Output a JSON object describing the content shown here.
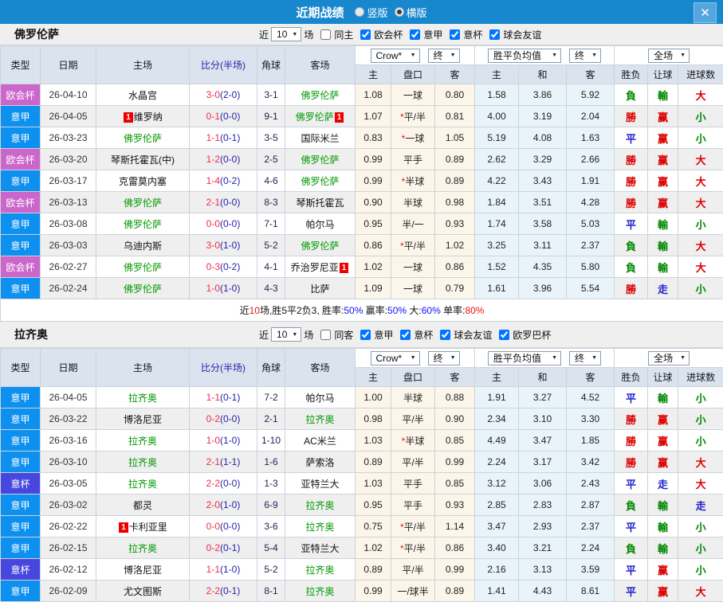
{
  "colors": {
    "titlebar": "#1787CE",
    "close-btn": "#53A7DE",
    "header-bg": "#DBE3EE",
    "euro-badge": "#CB66CB",
    "seriea-badge": "#0D90F0",
    "coppa-badge": "#4747DE",
    "self-team-green": "#009900",
    "score-red": "#F32A52",
    "score-half-navy": "#241FA8",
    "win-red": "#DD0000",
    "loss-green": "#008800",
    "draw-blue": "#2222CC",
    "odds-bg-cream": "#FCF5EA",
    "avg-bg-blue": "#E9F4FA",
    "redcard": "#EE0000"
  },
  "titlebar": {
    "title": "近期战绩",
    "close_glyph": "✕",
    "radios": [
      {
        "label": "竖版",
        "selected": false
      },
      {
        "label": "横版",
        "selected": true
      }
    ]
  },
  "table": {
    "left_headers": [
      "类型",
      "日期",
      "主场",
      "比分(半场)",
      "角球",
      "客场"
    ],
    "sub_headers": [
      "主",
      "盘口",
      "客",
      "主",
      "和",
      "客",
      "胜负",
      "让球",
      "进球数"
    ],
    "odds_dd": "Crow*",
    "odds_final_dd": "终",
    "avg_dd": "胜平负均值",
    "avg_final_dd": "终",
    "scope_dd": "全场"
  },
  "sections": [
    {
      "team": "佛罗伦萨",
      "near_label": "近",
      "count": "10",
      "games_label": "场",
      "same_label": "同主",
      "same_checked": false,
      "leagues": [
        {
          "label": "欧会杯",
          "checked": true
        },
        {
          "label": "意甲",
          "checked": true
        },
        {
          "label": "意杯",
          "checked": true
        },
        {
          "label": "球会友谊",
          "checked": true
        }
      ],
      "rows": [
        {
          "type": "欧会杯",
          "date": "26-04-10",
          "home": "水晶宫",
          "home_self": false,
          "score": "3-0",
          "half": "2-0",
          "corner": "3-1",
          "away": "佛罗伦萨",
          "away_self": true,
          "odds_home": "1.08",
          "handicap": "一球",
          "handicap_star": false,
          "odds_away": "0.80",
          "avg": [
            "1.58",
            "3.86",
            "5.92"
          ],
          "res": [
            [
              "負",
              "g"
            ],
            [
              "輸",
              "g"
            ],
            [
              "大",
              "r"
            ]
          ]
        },
        {
          "type": "意甲",
          "date": "26-04-05",
          "home": "维罗纳",
          "home_self": false,
          "home_badge": "1",
          "score": "0-1",
          "half": "0-0",
          "corner": "9-1",
          "away": "佛罗伦萨",
          "away_self": true,
          "away_badge": "1",
          "odds_home": "1.07",
          "handicap": "平/半",
          "handicap_star": true,
          "odds_away": "0.81",
          "avg": [
            "4.00",
            "3.19",
            "2.04"
          ],
          "res": [
            [
              "勝",
              "r"
            ],
            [
              "赢",
              "r"
            ],
            [
              "小",
              "g"
            ]
          ]
        },
        {
          "type": "意甲",
          "date": "26-03-23",
          "home": "佛罗伦萨",
          "home_self": true,
          "score": "1-1",
          "half": "0-1",
          "corner": "3-5",
          "away": "国际米兰",
          "away_self": false,
          "odds_home": "0.83",
          "handicap": "一球",
          "handicap_star": true,
          "odds_away": "1.05",
          "avg": [
            "5.19",
            "4.08",
            "1.63"
          ],
          "res": [
            [
              "平",
              "b"
            ],
            [
              "赢",
              "r"
            ],
            [
              "小",
              "g"
            ]
          ]
        },
        {
          "type": "欧会杯",
          "date": "26-03-20",
          "home": "琴斯托霍瓦(中)",
          "home_self": false,
          "score": "1-2",
          "half": "0-0",
          "corner": "2-5",
          "away": "佛罗伦萨",
          "away_self": true,
          "odds_home": "0.99",
          "handicap": "平手",
          "handicap_star": false,
          "odds_away": "0.89",
          "avg": [
            "2.62",
            "3.29",
            "2.66"
          ],
          "res": [
            [
              "勝",
              "r"
            ],
            [
              "赢",
              "r"
            ],
            [
              "大",
              "r"
            ]
          ]
        },
        {
          "type": "意甲",
          "date": "26-03-17",
          "home": "克雷莫内塞",
          "home_self": false,
          "score": "1-4",
          "half": "0-2",
          "corner": "4-6",
          "away": "佛罗伦萨",
          "away_self": true,
          "odds_home": "0.99",
          "handicap": "半球",
          "handicap_star": true,
          "odds_away": "0.89",
          "avg": [
            "4.22",
            "3.43",
            "1.91"
          ],
          "res": [
            [
              "勝",
              "r"
            ],
            [
              "赢",
              "r"
            ],
            [
              "大",
              "r"
            ]
          ]
        },
        {
          "type": "欧会杯",
          "date": "26-03-13",
          "home": "佛罗伦萨",
          "home_self": true,
          "score": "2-1",
          "half": "0-0",
          "corner": "8-3",
          "away": "琴斯托霍瓦",
          "away_self": false,
          "odds_home": "0.90",
          "handicap": "半球",
          "handicap_star": false,
          "odds_away": "0.98",
          "avg": [
            "1.84",
            "3.51",
            "4.28"
          ],
          "res": [
            [
              "勝",
              "r"
            ],
            [
              "赢",
              "r"
            ],
            [
              "大",
              "r"
            ]
          ]
        },
        {
          "type": "意甲",
          "date": "26-03-08",
          "home": "佛罗伦萨",
          "home_self": true,
          "score": "0-0",
          "half": "0-0",
          "corner": "7-1",
          "away": "帕尔马",
          "away_self": false,
          "odds_home": "0.95",
          "handicap": "半/一",
          "handicap_star": false,
          "odds_away": "0.93",
          "avg": [
            "1.74",
            "3.58",
            "5.03"
          ],
          "res": [
            [
              "平",
              "b"
            ],
            [
              "輸",
              "g"
            ],
            [
              "小",
              "g"
            ]
          ]
        },
        {
          "type": "意甲",
          "date": "26-03-03",
          "home": "乌迪内斯",
          "home_self": false,
          "score": "3-0",
          "half": "1-0",
          "corner": "5-2",
          "away": "佛罗伦萨",
          "away_self": true,
          "odds_home": "0.86",
          "handicap": "平/半",
          "handicap_star": true,
          "odds_away": "1.02",
          "avg": [
            "3.25",
            "3.11",
            "2.37"
          ],
          "res": [
            [
              "負",
              "g"
            ],
            [
              "輸",
              "g"
            ],
            [
              "大",
              "r"
            ]
          ]
        },
        {
          "type": "欧会杯",
          "date": "26-02-27",
          "home": "佛罗伦萨",
          "home_self": true,
          "score": "0-3",
          "half": "0-2",
          "corner": "4-1",
          "away": "乔治罗尼亚",
          "away_self": false,
          "away_badge": "1",
          "odds_home": "1.02",
          "handicap": "一球",
          "handicap_star": false,
          "odds_away": "0.86",
          "avg": [
            "1.52",
            "4.35",
            "5.80"
          ],
          "res": [
            [
              "負",
              "g"
            ],
            [
              "輸",
              "g"
            ],
            [
              "大",
              "r"
            ]
          ]
        },
        {
          "type": "意甲",
          "date": "26-02-24",
          "home": "佛罗伦萨",
          "home_self": true,
          "score": "1-0",
          "half": "1-0",
          "corner": "4-3",
          "away": "比萨",
          "away_self": false,
          "odds_home": "1.09",
          "handicap": "一球",
          "handicap_star": false,
          "odds_away": "0.79",
          "avg": [
            "1.61",
            "3.96",
            "5.54"
          ],
          "res": [
            [
              "勝",
              "r"
            ],
            [
              "走",
              "b"
            ],
            [
              "小",
              "g"
            ]
          ]
        }
      ],
      "summary": [
        {
          "text": "近",
          "color": "#111111"
        },
        {
          "text": "10",
          "color": "#EE1111"
        },
        {
          "text": "场,胜5平2负3, 胜率:",
          "color": "#111111"
        },
        {
          "text": "50%",
          "color": "#1111EE"
        },
        {
          "text": " 赢率:",
          "color": "#111111"
        },
        {
          "text": "50%",
          "color": "#1111EE"
        },
        {
          "text": " 大:",
          "color": "#111111"
        },
        {
          "text": "60%",
          "color": "#1111EE"
        },
        {
          "text": " 单率:",
          "color": "#111111"
        },
        {
          "text": "80%",
          "color": "#EE1111"
        }
      ]
    },
    {
      "team": "拉齐奥",
      "near_label": "近",
      "count": "10",
      "games_label": "场",
      "same_label": "同客",
      "same_checked": false,
      "leagues": [
        {
          "label": "意甲",
          "checked": true
        },
        {
          "label": "意杯",
          "checked": true
        },
        {
          "label": "球会友谊",
          "checked": true
        },
        {
          "label": "欧罗巴杯",
          "checked": true
        }
      ],
      "rows": [
        {
          "type": "意甲",
          "date": "26-04-05",
          "home": "拉齐奥",
          "home_self": true,
          "score": "1-1",
          "half": "0-1",
          "corner": "7-2",
          "away": "帕尔马",
          "away_self": false,
          "odds_home": "1.00",
          "handicap": "半球",
          "handicap_star": false,
          "odds_away": "0.88",
          "avg": [
            "1.91",
            "3.27",
            "4.52"
          ],
          "res": [
            [
              "平",
              "b"
            ],
            [
              "輸",
              "g"
            ],
            [
              "小",
              "g"
            ]
          ]
        },
        {
          "type": "意甲",
          "date": "26-03-22",
          "home": "博洛尼亚",
          "home_self": false,
          "score": "0-2",
          "half": "0-0",
          "corner": "2-1",
          "away": "拉齐奥",
          "away_self": true,
          "odds_home": "0.98",
          "handicap": "平/半",
          "handicap_star": false,
          "odds_away": "0.90",
          "avg": [
            "2.34",
            "3.10",
            "3.30"
          ],
          "res": [
            [
              "勝",
              "r"
            ],
            [
              "赢",
              "r"
            ],
            [
              "小",
              "g"
            ]
          ]
        },
        {
          "type": "意甲",
          "date": "26-03-16",
          "home": "拉齐奥",
          "home_self": true,
          "score": "1-0",
          "half": "1-0",
          "corner": "1-10",
          "away": "AC米兰",
          "away_self": false,
          "odds_home": "1.03",
          "handicap": "半球",
          "handicap_star": true,
          "odds_away": "0.85",
          "avg": [
            "4.49",
            "3.47",
            "1.85"
          ],
          "res": [
            [
              "勝",
              "r"
            ],
            [
              "赢",
              "r"
            ],
            [
              "小",
              "g"
            ]
          ]
        },
        {
          "type": "意甲",
          "date": "26-03-10",
          "home": "拉齐奥",
          "home_self": true,
          "score": "2-1",
          "half": "1-1",
          "corner": "1-6",
          "away": "萨索洛",
          "away_self": false,
          "odds_home": "0.89",
          "handicap": "平/半",
          "handicap_star": false,
          "odds_away": "0.99",
          "avg": [
            "2.24",
            "3.17",
            "3.42"
          ],
          "res": [
            [
              "勝",
              "r"
            ],
            [
              "赢",
              "r"
            ],
            [
              "大",
              "r"
            ]
          ]
        },
        {
          "type": "意杯",
          "date": "26-03-05",
          "home": "拉齐奥",
          "home_self": true,
          "score": "2-2",
          "half": "0-0",
          "corner": "1-3",
          "away": "亚特兰大",
          "away_self": false,
          "odds_home": "1.03",
          "handicap": "平手",
          "handicap_star": false,
          "odds_away": "0.85",
          "avg": [
            "3.12",
            "3.06",
            "2.43"
          ],
          "res": [
            [
              "平",
              "b"
            ],
            [
              "走",
              "b"
            ],
            [
              "大",
              "r"
            ]
          ]
        },
        {
          "type": "意甲",
          "date": "26-03-02",
          "home": "都灵",
          "home_self": false,
          "score": "2-0",
          "half": "1-0",
          "corner": "6-9",
          "away": "拉齐奥",
          "away_self": true,
          "odds_home": "0.95",
          "handicap": "平手",
          "handicap_star": false,
          "odds_away": "0.93",
          "avg": [
            "2.85",
            "2.83",
            "2.87"
          ],
          "res": [
            [
              "負",
              "g"
            ],
            [
              "輸",
              "g"
            ],
            [
              "走",
              "b"
            ]
          ]
        },
        {
          "type": "意甲",
          "date": "26-02-22",
          "home": "卡利亚里",
          "home_self": false,
          "home_badge": "1",
          "score": "0-0",
          "half": "0-0",
          "corner": "3-6",
          "away": "拉齐奥",
          "away_self": true,
          "odds_home": "0.75",
          "handicap": "平/半",
          "handicap_star": true,
          "odds_away": "1.14",
          "avg": [
            "3.47",
            "2.93",
            "2.37"
          ],
          "res": [
            [
              "平",
              "b"
            ],
            [
              "輸",
              "g"
            ],
            [
              "小",
              "g"
            ]
          ]
        },
        {
          "type": "意甲",
          "date": "26-02-15",
          "home": "拉齐奥",
          "home_self": true,
          "score": "0-2",
          "half": "0-1",
          "corner": "5-4",
          "away": "亚特兰大",
          "away_self": false,
          "odds_home": "1.02",
          "handicap": "平/半",
          "handicap_star": true,
          "odds_away": "0.86",
          "avg": [
            "3.40",
            "3.21",
            "2.24"
          ],
          "res": [
            [
              "負",
              "g"
            ],
            [
              "輸",
              "g"
            ],
            [
              "小",
              "g"
            ]
          ]
        },
        {
          "type": "意杯",
          "date": "26-02-12",
          "home": "博洛尼亚",
          "home_self": false,
          "score": "1-1",
          "half": "1-0",
          "corner": "5-2",
          "away": "拉齐奥",
          "away_self": true,
          "odds_home": "0.89",
          "handicap": "平/半",
          "handicap_star": false,
          "odds_away": "0.99",
          "avg": [
            "2.16",
            "3.13",
            "3.59"
          ],
          "res": [
            [
              "平",
              "b"
            ],
            [
              "赢",
              "r"
            ],
            [
              "小",
              "g"
            ]
          ]
        },
        {
          "type": "意甲",
          "date": "26-02-09",
          "home": "尤文图斯",
          "home_self": false,
          "score": "2-2",
          "half": "0-1",
          "corner": "8-1",
          "away": "拉齐奥",
          "away_self": true,
          "odds_home": "0.99",
          "handicap": "一/球半",
          "handicap_star": false,
          "odds_away": "0.89",
          "avg": [
            "1.41",
            "4.43",
            "8.61"
          ],
          "res": [
            [
              "平",
              "b"
            ],
            [
              "赢",
              "r"
            ],
            [
              "大",
              "r"
            ]
          ]
        }
      ],
      "summary": null
    }
  ]
}
